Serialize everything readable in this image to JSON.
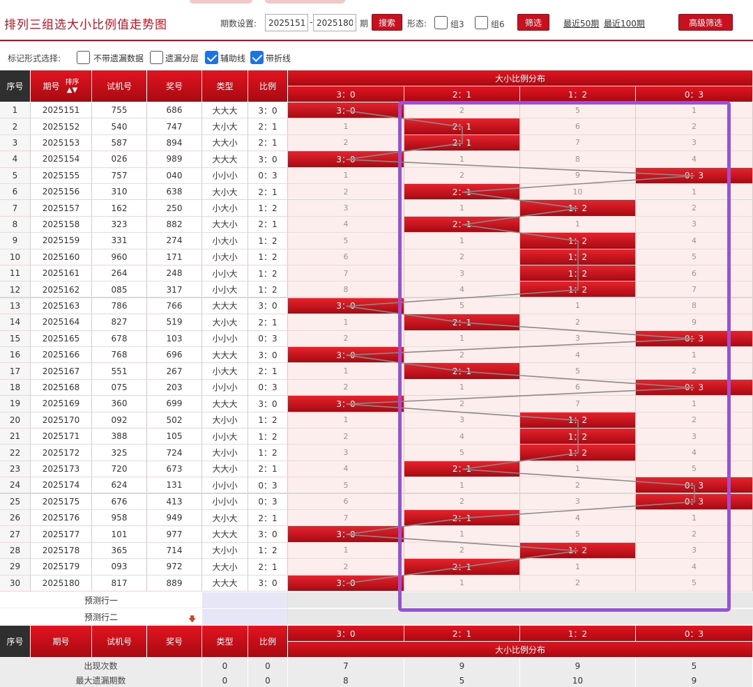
{
  "header": {
    "title": "排列三组选大小比例值走势图",
    "period_label": "期数设置:",
    "period_from": "2025151",
    "dash": "-",
    "period_to": "2025180",
    "period_unit": "期",
    "search_button": "搜索",
    "form_label": "形态:",
    "group3_label": "组3",
    "group6_label": "组6",
    "filter_button": "筛选",
    "recent50": "最近50期",
    "recent100": "最近100期",
    "advanced_button": "高级筛选"
  },
  "markbar": {
    "label": "标记形式选择:",
    "options": [
      {
        "label": "不带遗漏数据",
        "checked": false
      },
      {
        "label": "遗漏分层",
        "checked": false
      },
      {
        "label": "辅助线",
        "checked": true
      },
      {
        "label": "带折线",
        "checked": true
      }
    ]
  },
  "table_header": {
    "idx": "序号",
    "period": "期号",
    "sort": "排序",
    "test": "试机号",
    "prize": "奖号",
    "type": "类型",
    "ratio": "比例",
    "dist_title": "大小比例分布",
    "dist_cols": [
      "3：0",
      "2：1",
      "1：2",
      "0：3"
    ]
  },
  "rows": [
    {
      "idx": "1",
      "period": "2025151",
      "test": "755",
      "prize": "686",
      "type": "大大大",
      "ratio": "3：0",
      "hit": 0,
      "dist": [
        "3：0",
        "2",
        "5",
        "1"
      ]
    },
    {
      "idx": "2",
      "period": "2025152",
      "test": "540",
      "prize": "747",
      "type": "大小大",
      "ratio": "2：1",
      "hit": 1,
      "dist": [
        "1",
        "2：1",
        "6",
        "2"
      ]
    },
    {
      "idx": "3",
      "period": "2025153",
      "test": "587",
      "prize": "894",
      "type": "大大小",
      "ratio": "2：1",
      "hit": 1,
      "dist": [
        "2",
        "2：1",
        "7",
        "3"
      ]
    },
    {
      "idx": "4",
      "period": "2025154",
      "test": "026",
      "prize": "989",
      "type": "大大大",
      "ratio": "3：0",
      "hit": 0,
      "dist": [
        "3：0",
        "1",
        "8",
        "4"
      ]
    },
    {
      "idx": "5",
      "period": "2025155",
      "test": "757",
      "prize": "040",
      "type": "小小小",
      "ratio": "0：3",
      "hit": 3,
      "dist": [
        "1",
        "2",
        "9",
        "0：3"
      ]
    },
    {
      "idx": "6",
      "period": "2025156",
      "test": "310",
      "prize": "638",
      "type": "大小大",
      "ratio": "2：1",
      "hit": 1,
      "dist": [
        "2",
        "2：1",
        "10",
        "1"
      ]
    },
    {
      "idx": "7",
      "period": "2025157",
      "test": "162",
      "prize": "250",
      "type": "小大小",
      "ratio": "1：2",
      "hit": 2,
      "dist": [
        "3",
        "1",
        "1：2",
        "2"
      ]
    },
    {
      "idx": "8",
      "period": "2025158",
      "test": "323",
      "prize": "882",
      "type": "大大小",
      "ratio": "2：1",
      "hit": 1,
      "dist": [
        "4",
        "2：1",
        "1",
        "3"
      ]
    },
    {
      "idx": "9",
      "period": "2025159",
      "test": "331",
      "prize": "274",
      "type": "小大小",
      "ratio": "1：2",
      "hit": 2,
      "dist": [
        "5",
        "1",
        "1：2",
        "4"
      ]
    },
    {
      "idx": "10",
      "period": "2025160",
      "test": "960",
      "prize": "171",
      "type": "小大小",
      "ratio": "1：2",
      "hit": 2,
      "dist": [
        "6",
        "2",
        "1：2",
        "5"
      ]
    },
    {
      "idx": "11",
      "period": "2025161",
      "test": "264",
      "prize": "248",
      "type": "小小大",
      "ratio": "1：2",
      "hit": 2,
      "dist": [
        "7",
        "3",
        "1：2",
        "6"
      ]
    },
    {
      "idx": "12",
      "period": "2025162",
      "test": "085",
      "prize": "317",
      "type": "小小大",
      "ratio": "1：2",
      "hit": 2,
      "dist": [
        "8",
        "4",
        "1：2",
        "7"
      ]
    },
    {
      "idx": "13",
      "period": "2025163",
      "test": "786",
      "prize": "766",
      "type": "大大大",
      "ratio": "3：0",
      "hit": 0,
      "dist": [
        "3：0",
        "5",
        "1",
        "8"
      ]
    },
    {
      "idx": "14",
      "period": "2025164",
      "test": "827",
      "prize": "519",
      "type": "大小大",
      "ratio": "2：1",
      "hit": 1,
      "dist": [
        "1",
        "2：1",
        "2",
        "9"
      ]
    },
    {
      "idx": "15",
      "period": "2025165",
      "test": "678",
      "prize": "103",
      "type": "小小小",
      "ratio": "0：3",
      "hit": 3,
      "dist": [
        "2",
        "1",
        "3",
        "0：3"
      ]
    },
    {
      "idx": "16",
      "period": "2025166",
      "test": "768",
      "prize": "696",
      "type": "大大大",
      "ratio": "3：0",
      "hit": 0,
      "dist": [
        "3：0",
        "2",
        "4",
        "1"
      ]
    },
    {
      "idx": "17",
      "period": "2025167",
      "test": "551",
      "prize": "267",
      "type": "小大大",
      "ratio": "2：1",
      "hit": 1,
      "dist": [
        "1",
        "2：1",
        "5",
        "2"
      ]
    },
    {
      "idx": "18",
      "period": "2025168",
      "test": "075",
      "prize": "203",
      "type": "小小小",
      "ratio": "0：3",
      "hit": 3,
      "dist": [
        "2",
        "1",
        "6",
        "0：3"
      ]
    },
    {
      "idx": "19",
      "period": "2025169",
      "test": "360",
      "prize": "699",
      "type": "大大大",
      "ratio": "3：0",
      "hit": 0,
      "dist": [
        "3：0",
        "2",
        "7",
        "1"
      ]
    },
    {
      "idx": "20",
      "period": "2025170",
      "test": "092",
      "prize": "502",
      "type": "大小小",
      "ratio": "1：2",
      "hit": 2,
      "dist": [
        "1",
        "3",
        "1：2",
        "2"
      ]
    },
    {
      "idx": "21",
      "period": "2025171",
      "test": "388",
      "prize": "105",
      "type": "小小大",
      "ratio": "1：2",
      "hit": 2,
      "dist": [
        "2",
        "4",
        "1：2",
        "3"
      ]
    },
    {
      "idx": "22",
      "period": "2025172",
      "test": "325",
      "prize": "724",
      "type": "大小小",
      "ratio": "1：2",
      "hit": 2,
      "dist": [
        "3",
        "5",
        "1：2",
        "4"
      ]
    },
    {
      "idx": "23",
      "period": "2025173",
      "test": "720",
      "prize": "673",
      "type": "大大小",
      "ratio": "2：1",
      "hit": 1,
      "dist": [
        "4",
        "2：1",
        "1",
        "5"
      ]
    },
    {
      "idx": "24",
      "period": "2025174",
      "test": "624",
      "prize": "131",
      "type": "小小小",
      "ratio": "0：3",
      "hit": 3,
      "dist": [
        "5",
        "1",
        "2",
        "0：3"
      ]
    },
    {
      "idx": "25",
      "period": "2025175",
      "test": "676",
      "prize": "413",
      "type": "小小小",
      "ratio": "0：3",
      "hit": 3,
      "dist": [
        "6",
        "2",
        "3",
        "0：3"
      ]
    },
    {
      "idx": "26",
      "period": "2025176",
      "test": "958",
      "prize": "949",
      "type": "大小大",
      "ratio": "2：1",
      "hit": 1,
      "dist": [
        "7",
        "2：1",
        "4",
        "1"
      ]
    },
    {
      "idx": "27",
      "period": "2025177",
      "test": "101",
      "prize": "977",
      "type": "大大大",
      "ratio": "3：0",
      "hit": 0,
      "dist": [
        "3：0",
        "1",
        "5",
        "2"
      ]
    },
    {
      "idx": "28",
      "period": "2025178",
      "test": "365",
      "prize": "714",
      "type": "大小小",
      "ratio": "1：2",
      "hit": 2,
      "dist": [
        "1",
        "2",
        "1：2",
        "3"
      ]
    },
    {
      "idx": "29",
      "period": "2025179",
      "test": "093",
      "prize": "972",
      "type": "大大小",
      "ratio": "2：1",
      "hit": 1,
      "dist": [
        "2",
        "2：1",
        "1",
        "4"
      ]
    },
    {
      "idx": "30",
      "period": "2025180",
      "test": "817",
      "prize": "889",
      "type": "大大大",
      "ratio": "3：0",
      "hit": 0,
      "dist": [
        "3：0",
        "1",
        "2",
        "5"
      ]
    }
  ],
  "predict": [
    "预测行一",
    "预测行二"
  ],
  "stats": [
    {
      "label": "出现次数",
      "type": "0",
      "ratio": "0",
      "values": [
        "7",
        "9",
        "9",
        "5"
      ]
    },
    {
      "label": "最大遗漏期数",
      "type": "0",
      "ratio": "0",
      "values": [
        "8",
        "5",
        "10",
        "9"
      ]
    }
  ],
  "colors": {
    "accent_red": "#c8101e",
    "highlight_purple": "#9b4dea",
    "check_blue": "#1a73e8"
  }
}
